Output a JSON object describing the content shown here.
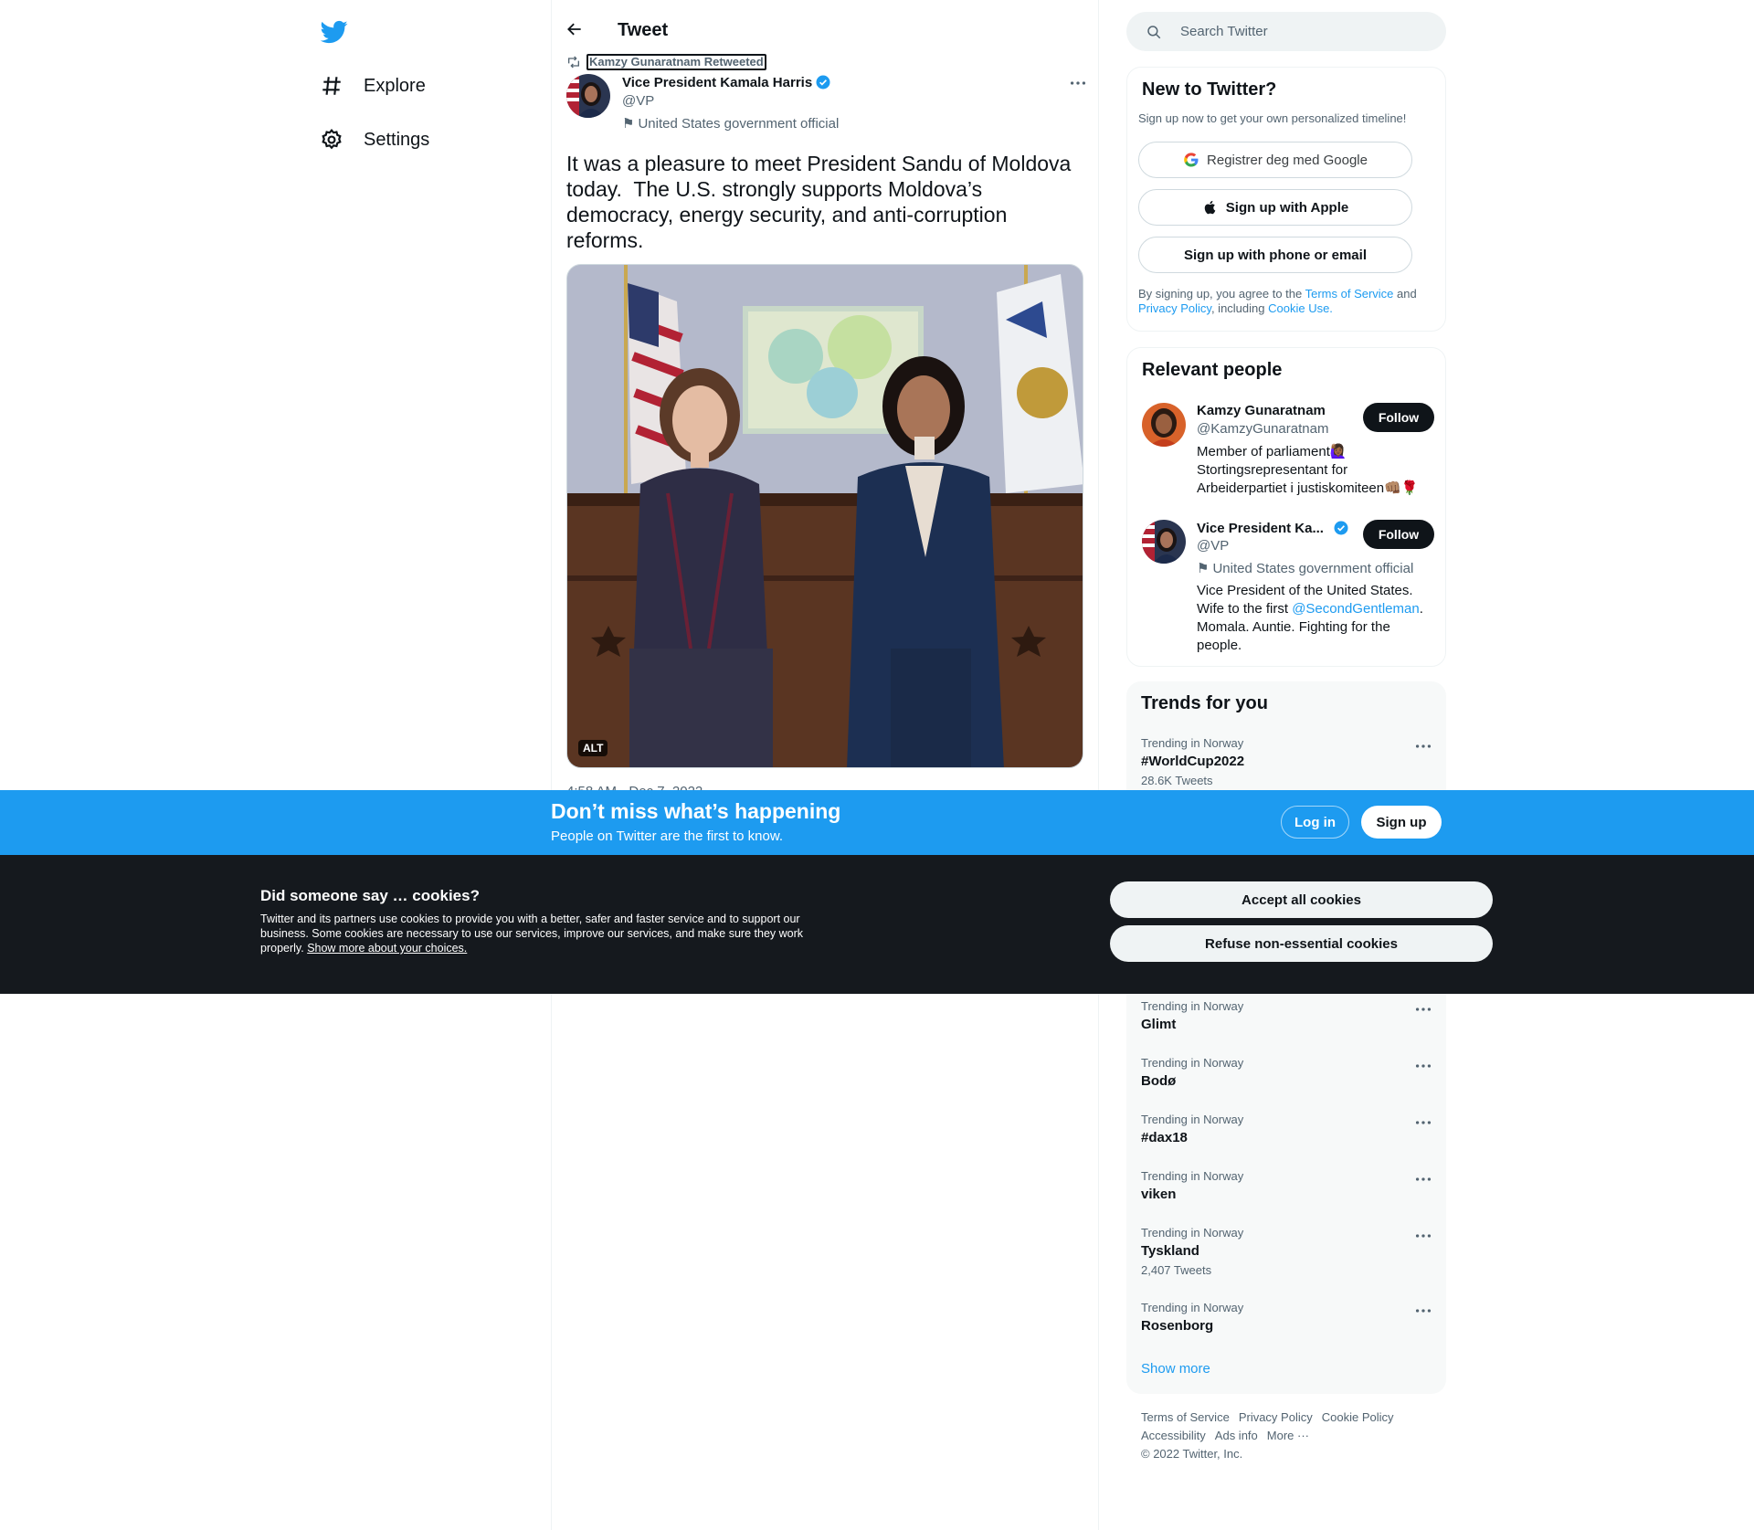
{
  "colors": {
    "brand": "#1d9bf0",
    "text_primary": "#0f1419",
    "text_secondary": "#536471",
    "cookie_bg": "#15191e"
  },
  "nav": {
    "logo_icon": "twitter-bird-icon",
    "items": [
      {
        "label": "Explore",
        "icon": "hashtag-icon"
      },
      {
        "label": "Settings",
        "icon": "gear-icon"
      }
    ]
  },
  "header": {
    "title": "Tweet",
    "back_icon": "arrow-left-icon"
  },
  "tweet": {
    "retweeted_by": "Kamzy Gunaratnam Retweeted",
    "author_name": "Vice President Kamala Harris",
    "author_handle": "@VP",
    "affiliation": "United States government official",
    "text": "It was a pleasure to meet President Sandu of Moldova today.  The U.S. strongly supports Moldova’s democracy, energy security, and anti-corruption reforms.",
    "alt_label": "ALT",
    "timestamp": "4:58 AM · Dec 7, 2022"
  },
  "search": {
    "placeholder": "Search Twitter"
  },
  "new_to_twitter": {
    "title": "New to Twitter?",
    "subtitle": "Sign up now to get your own personalized timeline!",
    "google_label": "Registrer deg med Google",
    "apple_label": "Sign up with Apple",
    "phone_label": "Sign up with phone or email",
    "terms_prefix": "By signing up, you agree to the ",
    "terms_link": "Terms of Service",
    "terms_and": " and ",
    "privacy_link": "Privacy Policy",
    "terms_including": ", including ",
    "cookie_link": "Cookie Use."
  },
  "relevant_people": {
    "title": "Relevant people",
    "people": [
      {
        "name": "Kamzy Gunaratnam",
        "handle": "@KamzyGunaratnam",
        "bio": "Member of parliament🙋🏾‍♀️ Stortingsrepresentant for Arbeiderpartiet i justiskomiteen👊🏽🌹",
        "follow_label": "Follow"
      },
      {
        "name": "Vice President Ka...",
        "handle": "@VP",
        "affiliation": "United States government official",
        "bio_prefix": "Vice President of the United States. Wife to the first ",
        "bio_link": "@SecondGentleman",
        "bio_suffix": ". Momala. Auntie. Fighting for the people.",
        "follow_label": "Follow"
      }
    ]
  },
  "trends": {
    "title": "Trends for you",
    "items": [
      {
        "context": "Trending in Norway",
        "name": "#WorldCup2022",
        "count": "28.6K Tweets"
      },
      {
        "context": "Trending in Norway",
        "name": "Glimt",
        "count": ""
      },
      {
        "context": "Trending in Norway",
        "name": "Bodø",
        "count": ""
      },
      {
        "context": "Trending in Norway",
        "name": "#dax18",
        "count": ""
      },
      {
        "context": "Trending in Norway",
        "name": "viken",
        "count": ""
      },
      {
        "context": "Trending in Norway",
        "name": "Tyskland",
        "count": "2,407 Tweets"
      },
      {
        "context": "Trending in Norway",
        "name": "Rosenborg",
        "count": ""
      }
    ],
    "show_more": "Show more"
  },
  "footer": {
    "links": [
      "Terms of Service",
      "Privacy Policy",
      "Cookie Policy",
      "Accessibility",
      "Ads info",
      "More ···"
    ],
    "copyright": "© 2022 Twitter, Inc."
  },
  "signup_bar": {
    "title": "Don’t miss what’s happening",
    "subtitle": "People on Twitter are the first to know.",
    "login_label": "Log in",
    "signup_label": "Sign up"
  },
  "cookie_banner": {
    "title": "Did someone say … cookies?",
    "text": "Twitter and its partners use cookies to provide you with a better, safer and faster service and to support our business. Some cookies are necessary to use our services, improve our services, and make sure they work properly. ",
    "link": "Show more about your choices.",
    "accept_label": "Accept all cookies",
    "refuse_label": "Refuse non-essential cookies"
  }
}
